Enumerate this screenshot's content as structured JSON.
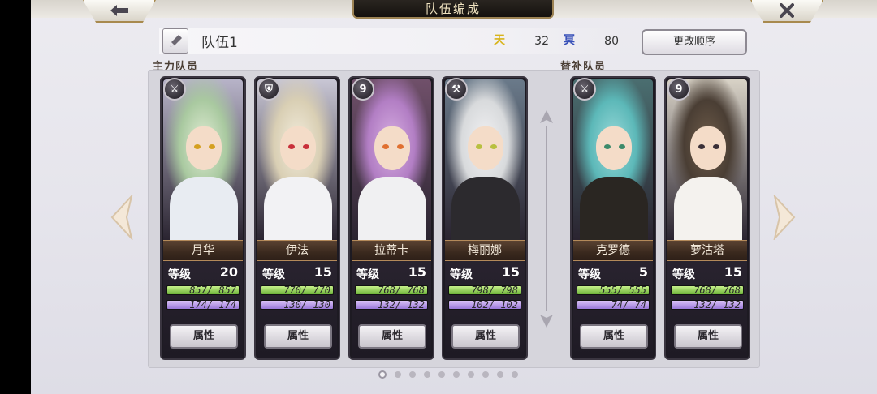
{
  "header": {
    "title": "队伍编成",
    "back_icon": "back-arrow-icon",
    "close_icon": "close-icon"
  },
  "party": {
    "name": "队伍1",
    "cost_a_icon": "天",
    "cost_a_value": "32",
    "cost_b_icon": "冥",
    "cost_b_value": "80",
    "reorder_label": "更改顺序"
  },
  "sections": {
    "main_label": "主力队员",
    "sub_label": "替补队员"
  },
  "level_label": "等级",
  "attr_label": "属性",
  "characters": [
    {
      "name": "月华",
      "level": "20",
      "class_icon": "bow-class-icon",
      "class_glyph": "⚔",
      "hp": "857/ 857",
      "hp_pct": 1.0,
      "mp": "174/ 174",
      "mp_pct": 1.0,
      "hair": "#a9c9a0",
      "hair2": "#e0ecd4",
      "eye": "#d4a020",
      "outfit": "#e8ecf2",
      "bg": "#b7b3c8"
    },
    {
      "name": "伊法",
      "level": "15",
      "class_icon": "shield-class-icon",
      "class_glyph": "⛨",
      "hp": "770/ 770",
      "hp_pct": 1.0,
      "mp": "130/ 130",
      "mp_pct": 1.0,
      "hair": "#d9cfb4",
      "hair2": "#f2ecdc",
      "eye": "#c8303a",
      "outfit": "#f2f2f4",
      "bg": "#c8c6d4"
    },
    {
      "name": "拉蒂卡",
      "level": "15",
      "class_icon": "staff-class-icon",
      "class_glyph": "9",
      "hp": "768/ 768",
      "hp_pct": 1.0,
      "mp": "132/ 132",
      "mp_pct": 1.0,
      "hair": "#b27ec4",
      "hair2": "#d7aee2",
      "eye": "#e07030",
      "outfit": "#f0f0f2",
      "bg": "#70506a"
    },
    {
      "name": "梅丽娜",
      "level": "15",
      "class_icon": "hammer-class-icon",
      "class_glyph": "⚒",
      "hp": "798/ 798",
      "hp_pct": 1.0,
      "mp": "102/ 102",
      "mp_pct": 1.0,
      "hair": "#d8dadc",
      "hair2": "#f2f2f4",
      "eye": "#b8c040",
      "outfit": "#2c2a2e",
      "bg": "#6a7a8a"
    },
    {
      "name": "克罗德",
      "level": "5",
      "class_icon": "bow-class-icon",
      "class_glyph": "⚔",
      "hp": "555/ 555",
      "hp_pct": 1.0,
      "mp": "74/ 74",
      "mp_pct": 1.0,
      "hair": "#5cb8b8",
      "hair2": "#9adada",
      "eye": "#3c8a6a",
      "outfit": "#2a2622",
      "bg": "#4a6e70"
    },
    {
      "name": "萝沽塔",
      "level": "15",
      "class_icon": "staff-class-icon",
      "class_glyph": "9",
      "hp": "768/ 768",
      "hp_pct": 1.0,
      "mp": "132/ 132",
      "mp_pct": 1.0,
      "hair": "#4a3e34",
      "hair2": "#6e5c4a",
      "eye": "#3a3038",
      "outfit": "#f4f2ee",
      "bg": "#d8d2c6"
    }
  ],
  "pagination": {
    "pages": 10,
    "current": 1
  }
}
